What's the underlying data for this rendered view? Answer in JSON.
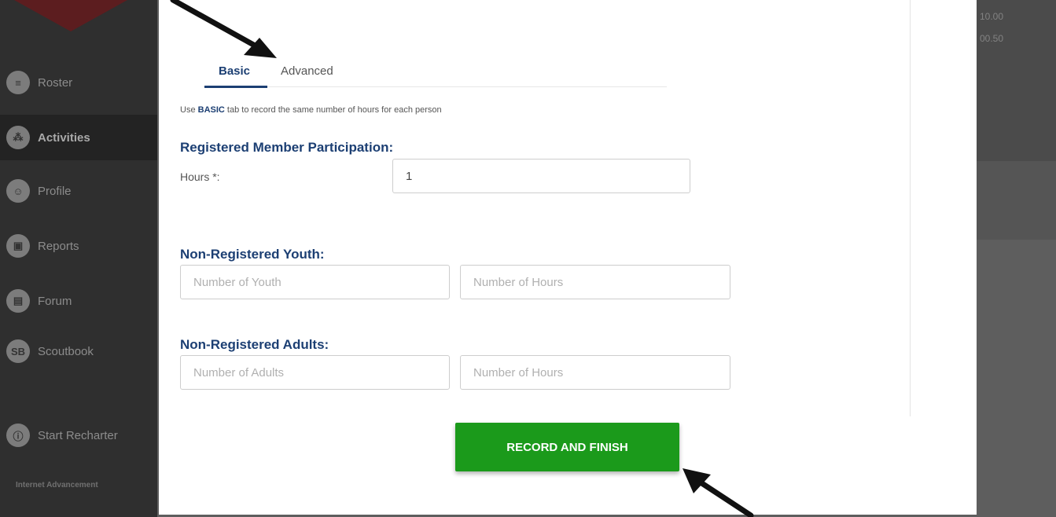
{
  "sidebar": {
    "items": [
      {
        "icon": "list-icon",
        "glyph": "≡",
        "label": "Roster"
      },
      {
        "icon": "activities-icon",
        "glyph": "⁂",
        "label": "Activities"
      },
      {
        "icon": "profile-icon",
        "glyph": "☺",
        "label": "Profile"
      },
      {
        "icon": "reports-icon",
        "glyph": "▣",
        "label": "Reports"
      },
      {
        "icon": "forum-icon",
        "glyph": "▤",
        "label": "Forum"
      },
      {
        "icon": "scoutbook-icon",
        "glyph": "SB",
        "label": "Scoutbook"
      },
      {
        "icon": "info-icon",
        "glyph": "ⓘ",
        "label": "Start Recharter"
      }
    ],
    "footer": "Internet Advancement"
  },
  "background": {
    "amount_1": "10.00",
    "amount_2": "00.50"
  },
  "modal": {
    "tabs": [
      {
        "label": "Basic",
        "active": true
      },
      {
        "label": "Advanced",
        "active": false
      }
    ],
    "helper": {
      "prefix": "Use ",
      "emphasis": "BASIC",
      "suffix": " tab to record the same number of hours for each person"
    },
    "registered": {
      "title": "Registered Member Participation:",
      "hours_label": "Hours *:",
      "hours_value": "1"
    },
    "youth": {
      "title": "Non-Registered Youth:",
      "count_placeholder": "Number of Youth",
      "hours_placeholder": "Number of Hours"
    },
    "adults": {
      "title": "Non-Registered Adults:",
      "count_placeholder": "Number of Adults",
      "hours_placeholder": "Number of Hours"
    },
    "submit_label": "RECORD AND FINISH"
  },
  "colors": {
    "accent": "#1c3f73",
    "button": "#1b9a1b"
  }
}
